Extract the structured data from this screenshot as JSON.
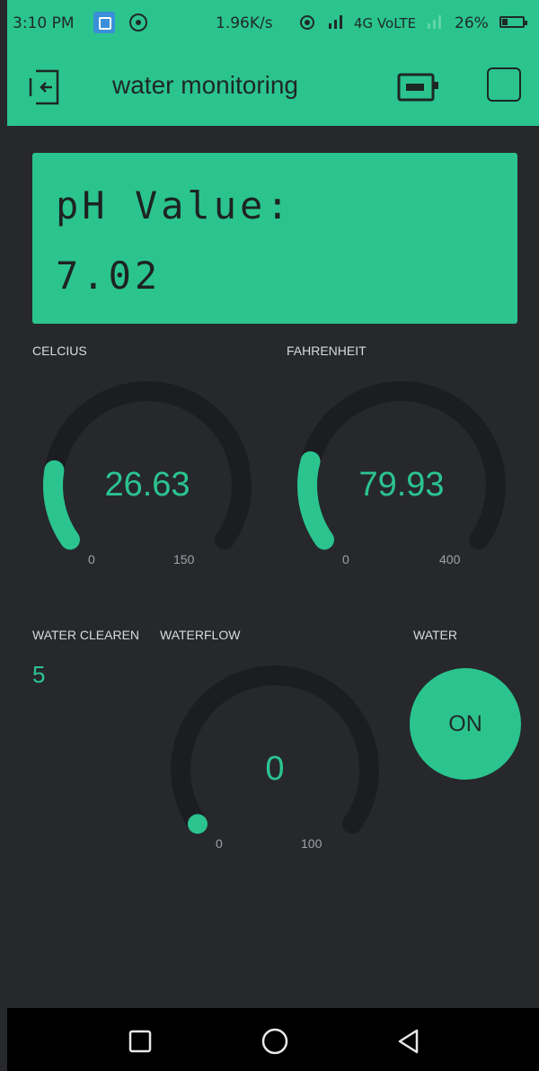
{
  "status_bar": {
    "time": "3:10 PM",
    "network_speed": "1.96K/s",
    "signal_text": "4G VoLTE",
    "battery": "26%",
    "icons": [
      "screenshot-icon",
      "sync-icon",
      "hotspot-icon",
      "signal-icon",
      "battery-icon"
    ]
  },
  "app_bar": {
    "title": "water monitoring",
    "icons": [
      "exit-icon",
      "device-icon",
      "square-icon"
    ]
  },
  "lcd": {
    "line1": "pH Value:",
    "line2": "7.02"
  },
  "gauges": {
    "celcius": {
      "label": "CELCIUS",
      "value": "26.63",
      "min": "0",
      "max": "150",
      "level": 0.1775
    },
    "fahrenheit": {
      "label": "FAHRENHEIT",
      "value": "79.93",
      "min": "0",
      "max": "400",
      "level": 0.1998
    },
    "waterflow": {
      "label": "WATERFLOW",
      "value": "0",
      "min": "0",
      "max": "100",
      "level": 0
    }
  },
  "water_clearen": {
    "label": "WATER CLEAREN",
    "value": "5"
  },
  "water_button": {
    "label": "WATER",
    "state": "ON"
  },
  "colors": {
    "accent": "#2bc48f",
    "background": "#26282c",
    "track": "#1b1d20"
  },
  "nav_bar": {
    "icons": [
      "recents-icon",
      "home-icon",
      "back-icon"
    ]
  }
}
